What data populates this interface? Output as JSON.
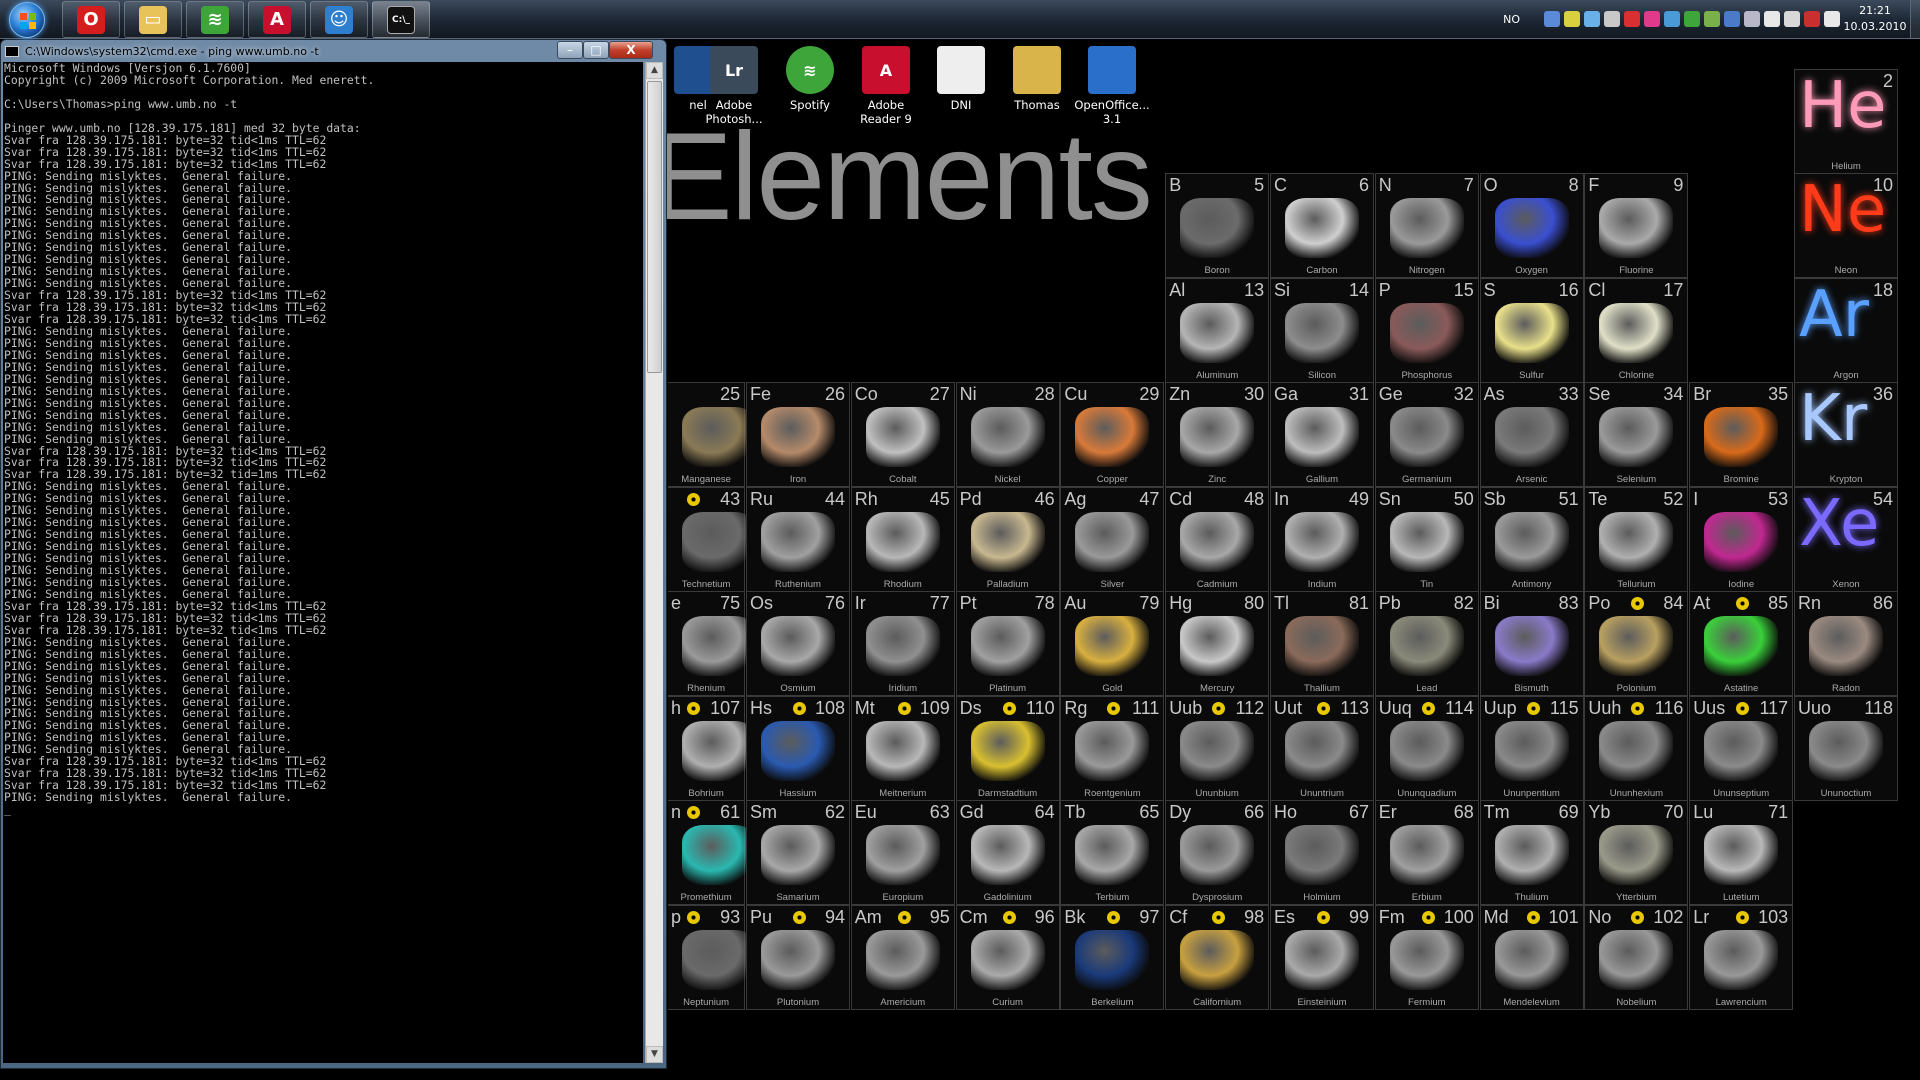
{
  "taskbar": {
    "apps": [
      {
        "name": "Opera",
        "icon": "opera-icon",
        "color": "#d41d1d",
        "glyph": "O"
      },
      {
        "name": "Windows Explorer",
        "icon": "folder-icon",
        "color": "#e8c35a",
        "glyph": "▭"
      },
      {
        "name": "Spotify",
        "icon": "spotify-icon",
        "color": "#3ea53a",
        "glyph": "≋"
      },
      {
        "name": "Adobe Reader",
        "icon": "acrobat-icon",
        "color": "#c8102e",
        "glyph": "A"
      },
      {
        "name": "Users",
        "icon": "users-icon",
        "color": "#2f7fcf",
        "glyph": "☺"
      },
      {
        "name": "Command Prompt",
        "icon": "cmd-icon",
        "color": "#111111",
        "glyph": "C:\\_"
      }
    ],
    "tray_language": "NO",
    "clock_time": "21:21",
    "clock_date": "10.03.2010"
  },
  "cmd": {
    "title": "C:\\Windows\\system32\\cmd.exe - ping  www.umb.no -t",
    "buttons": {
      "minimize": "–",
      "maximize": "□",
      "close": "X"
    },
    "output": "Microsoft Windows [Versjon 6.1.7600]\nCopyright (c) 2009 Microsoft Corporation. Med enerett.\n\nC:\\Users\\Thomas>ping www.umb.no -t\n\nPinger www.umb.no [128.39.175.181] med 32 byte data:\nSvar fra 128.39.175.181: byte=32 tid<1ms TTL=62\nSvar fra 128.39.175.181: byte=32 tid<1ms TTL=62\nSvar fra 128.39.175.181: byte=32 tid<1ms TTL=62\nPING: Sending mislyktes.  General failure.\nPING: Sending mislyktes.  General failure.\nPING: Sending mislyktes.  General failure.\nPING: Sending mislyktes.  General failure.\nPING: Sending mislyktes.  General failure.\nPING: Sending mislyktes.  General failure.\nPING: Sending mislyktes.  General failure.\nPING: Sending mislyktes.  General failure.\nPING: Sending mislyktes.  General failure.\nPING: Sending mislyktes.  General failure.\nSvar fra 128.39.175.181: byte=32 tid<1ms TTL=62\nSvar fra 128.39.175.181: byte=32 tid<1ms TTL=62\nSvar fra 128.39.175.181: byte=32 tid<1ms TTL=62\nPING: Sending mislyktes.  General failure.\nPING: Sending mislyktes.  General failure.\nPING: Sending mislyktes.  General failure.\nPING: Sending mislyktes.  General failure.\nPING: Sending mislyktes.  General failure.\nPING: Sending mislyktes.  General failure.\nPING: Sending mislyktes.  General failure.\nPING: Sending mislyktes.  General failure.\nPING: Sending mislyktes.  General failure.\nPING: Sending mislyktes.  General failure.\nSvar fra 128.39.175.181: byte=32 tid<1ms TTL=62\nSvar fra 128.39.175.181: byte=32 tid<1ms TTL=62\nSvar fra 128.39.175.181: byte=32 tid=1ms TTL=62\nPING: Sending mislyktes.  General failure.\nPING: Sending mislyktes.  General failure.\nPING: Sending mislyktes.  General failure.\nPING: Sending mislyktes.  General failure.\nPING: Sending mislyktes.  General failure.\nPING: Sending mislyktes.  General failure.\nPING: Sending mislyktes.  General failure.\nPING: Sending mislyktes.  General failure.\nPING: Sending mislyktes.  General failure.\nPING: Sending mislyktes.  General failure.\nSvar fra 128.39.175.181: byte=32 tid<1ms TTL=62\nSvar fra 128.39.175.181: byte=32 tid<1ms TTL=62\nSvar fra 128.39.175.181: byte=32 tid<1ms TTL=62\nPING: Sending mislyktes.  General failure.\nPING: Sending mislyktes.  General failure.\nPING: Sending mislyktes.  General failure.\nPING: Sending mislyktes.  General failure.\nPING: Sending mislyktes.  General failure.\nPING: Sending mislyktes.  General failure.\nPING: Sending mislyktes.  General failure.\nPING: Sending mislyktes.  General failure.\nPING: Sending mislyktes.  General failure.\nPING: Sending mislyktes.  General failure.\nSvar fra 128.39.175.181: byte=32 tid<1ms TTL=62\nSvar fra 128.39.175.181: byte=32 tid<1ms TTL=62\nSvar fra 128.39.175.181: byte=32 tid<1ms TTL=62\nPING: Sending mislyktes.  General failure.\n_"
  },
  "desktop_icons": [
    {
      "label": "nel",
      "icon": "control-panel-icon",
      "color": "#1f4f8f",
      "glyph": ""
    },
    {
      "label": "Adobe Photosh...",
      "icon": "lightroom-icon",
      "color": "#3a4a5a",
      "glyph": "Lr"
    },
    {
      "label": "Spotify",
      "icon": "spotify-icon",
      "color": "#3ea53a",
      "glyph": "≋"
    },
    {
      "label": "Adobe Reader 9",
      "icon": "acrobat-icon",
      "color": "#c8102e",
      "glyph": "A"
    },
    {
      "label": "DNI",
      "icon": "document-icon",
      "color": "#eeeeee",
      "glyph": ""
    },
    {
      "label": "Thomas",
      "icon": "user-folder-icon",
      "color": "#d9b44a",
      "glyph": ""
    },
    {
      "label": "OpenOffice... 3.1",
      "icon": "openoffice-icon",
      "color": "#2a6fc9",
      "glyph": ""
    }
  ],
  "wallpaper": {
    "title": "Elements",
    "elements": [
      {
        "sym": "He",
        "num": "2",
        "name": "Helium",
        "glow": "#ff9ab8"
      },
      {
        "sym": "B",
        "num": "5",
        "name": "Boron",
        "color": "#6b6b6b"
      },
      {
        "sym": "C",
        "num": "6",
        "name": "Carbon",
        "color": "#cfcfcf"
      },
      {
        "sym": "N",
        "num": "7",
        "name": "Nitrogen",
        "color": "#9a9a9a"
      },
      {
        "sym": "O",
        "num": "8",
        "name": "Oxygen",
        "color": "#3a4fd0"
      },
      {
        "sym": "F",
        "num": "9",
        "name": "Fluorine",
        "color": "#aaaaaa"
      },
      {
        "sym": "Ne",
        "num": "10",
        "name": "Neon",
        "glow": "#ff3b1a"
      },
      {
        "sym": "Al",
        "num": "13",
        "name": "Aluminum",
        "color": "#b5b5b5"
      },
      {
        "sym": "Si",
        "num": "14",
        "name": "Silicon",
        "color": "#8d8d8d"
      },
      {
        "sym": "P",
        "num": "15",
        "name": "Phosphorus",
        "color": "#8a5a5a"
      },
      {
        "sym": "S",
        "num": "16",
        "name": "Sulfur",
        "color": "#e8e08a"
      },
      {
        "sym": "Cl",
        "num": "17",
        "name": "Chlorine",
        "color": "#e0e0c8"
      },
      {
        "sym": "Ar",
        "num": "18",
        "name": "Argon",
        "glow": "#5aa0ff"
      },
      {
        "sym": "",
        "num": "25",
        "name": "Manganese",
        "color": "#8a7a55",
        "partial": true
      },
      {
        "sym": "Fe",
        "num": "26",
        "name": "Iron",
        "color": "#b58a6a"
      },
      {
        "sym": "Co",
        "num": "27",
        "name": "Cobalt",
        "color": "#c0c0c0"
      },
      {
        "sym": "Ni",
        "num": "28",
        "name": "Nickel",
        "color": "#9a9a9a"
      },
      {
        "sym": "Cu",
        "num": "29",
        "name": "Copper",
        "color": "#d87a3a"
      },
      {
        "sym": "Zn",
        "num": "30",
        "name": "Zinc",
        "color": "#a8a8a8"
      },
      {
        "sym": "Ga",
        "num": "31",
        "name": "Gallium",
        "color": "#bdbdbd"
      },
      {
        "sym": "Ge",
        "num": "32",
        "name": "Germanium",
        "color": "#8a8a8a"
      },
      {
        "sym": "As",
        "num": "33",
        "name": "Arsenic",
        "color": "#7a7a7a"
      },
      {
        "sym": "Se",
        "num": "34",
        "name": "Selenium",
        "color": "#9a9a9a"
      },
      {
        "sym": "Br",
        "num": "35",
        "name": "Bromine",
        "color": "#d86a1a"
      },
      {
        "sym": "Kr",
        "num": "36",
        "name": "Krypton",
        "glow": "#a8c8ff"
      },
      {
        "sym": "",
        "num": "43",
        "name": "Technetium",
        "color": "#6a6a6a",
        "partial": true,
        "rad": true
      },
      {
        "sym": "Ru",
        "num": "44",
        "name": "Ruthenium",
        "color": "#a0a0a0"
      },
      {
        "sym": "Rh",
        "num": "45",
        "name": "Rhodium",
        "color": "#b8b8b8"
      },
      {
        "sym": "Pd",
        "num": "46",
        "name": "Palladium",
        "color": "#c8b890"
      },
      {
        "sym": "Ag",
        "num": "47",
        "name": "Silver",
        "color": "#9a9a9a"
      },
      {
        "sym": "Cd",
        "num": "48",
        "name": "Cadmium",
        "color": "#a8a8a8"
      },
      {
        "sym": "In",
        "num": "49",
        "name": "Indium",
        "color": "#b0b0b0"
      },
      {
        "sym": "Sn",
        "num": "50",
        "name": "Tin",
        "color": "#b8b8b8"
      },
      {
        "sym": "Sb",
        "num": "51",
        "name": "Antimony",
        "color": "#9a9a9a"
      },
      {
        "sym": "Te",
        "num": "52",
        "name": "Tellurium",
        "color": "#b0b0b0"
      },
      {
        "sym": "I",
        "num": "53",
        "name": "Iodine",
        "color": "#c02890"
      },
      {
        "sym": "Xe",
        "num": "54",
        "name": "Xenon",
        "glow": "#7a6aff"
      },
      {
        "sym": "e",
        "num": "75",
        "name": "Rhenium",
        "color": "#9a9a9a",
        "partial": true
      },
      {
        "sym": "Os",
        "num": "76",
        "name": "Osmium",
        "color": "#a8a8a8"
      },
      {
        "sym": "Ir",
        "num": "77",
        "name": "Iridium",
        "color": "#909090"
      },
      {
        "sym": "Pt",
        "num": "78",
        "name": "Platinum",
        "color": "#a0a0a0"
      },
      {
        "sym": "Au",
        "num": "79",
        "name": "Gold",
        "color": "#d8b040"
      },
      {
        "sym": "Hg",
        "num": "80",
        "name": "Mercury",
        "color": "#c8c8c8"
      },
      {
        "sym": "Tl",
        "num": "81",
        "name": "Thallium",
        "color": "#8a6a5a"
      },
      {
        "sym": "Pb",
        "num": "82",
        "name": "Lead",
        "color": "#8a8a7a"
      },
      {
        "sym": "Bi",
        "num": "83",
        "name": "Bismuth",
        "color": "#8a7ac8"
      },
      {
        "sym": "Po",
        "num": "84",
        "name": "Polonium",
        "color": "#b8a060",
        "rad": true
      },
      {
        "sym": "At",
        "num": "85",
        "name": "Astatine",
        "color": "#3ad03a",
        "rad": true
      },
      {
        "sym": "Rn",
        "num": "86",
        "name": "Radon",
        "color": "#9a8a80"
      },
      {
        "sym": "h",
        "num": "107",
        "name": "Bohrium",
        "color": "#b0b0b0",
        "partial": true,
        "rad": true
      },
      {
        "sym": "Hs",
        "num": "108",
        "name": "Hassium",
        "color": "#2a5ab0",
        "rad": true
      },
      {
        "sym": "Mt",
        "num": "109",
        "name": "Meitnerium",
        "color": "#b8b8b8",
        "rad": true
      },
      {
        "sym": "Ds",
        "num": "110",
        "name": "Darmstadtium",
        "color": "#d8c030",
        "rad": true
      },
      {
        "sym": "Rg",
        "num": "111",
        "name": "Roentgenium",
        "color": "#9a9a9a",
        "rad": true
      },
      {
        "sym": "Uub",
        "num": "112",
        "name": "Ununbium",
        "color": "#8a8a8a",
        "rad": true
      },
      {
        "sym": "Uut",
        "num": "113",
        "name": "Ununtrium",
        "color": "#8a8a8a",
        "rad": true
      },
      {
        "sym": "Uuq",
        "num": "114",
        "name": "Ununquadium",
        "color": "#8a8a8a",
        "rad": true
      },
      {
        "sym": "Uup",
        "num": "115",
        "name": "Ununpentium",
        "color": "#8a8a8a",
        "rad": true
      },
      {
        "sym": "Uuh",
        "num": "116",
        "name": "Ununhexium",
        "color": "#8a8a8a",
        "rad": true
      },
      {
        "sym": "Uus",
        "num": "117",
        "name": "Ununseptium",
        "color": "#8a8a8a",
        "rad": true
      },
      {
        "sym": "Uuo",
        "num": "118",
        "name": "Ununoctium",
        "color": "#8a8a8a"
      },
      {
        "sym": "n",
        "num": "61",
        "name": "Promethium",
        "color": "#2ab8b0",
        "partial": true,
        "rad": true
      },
      {
        "sym": "Sm",
        "num": "62",
        "name": "Samarium",
        "color": "#a8a8a8"
      },
      {
        "sym": "Eu",
        "num": "63",
        "name": "Europium",
        "color": "#a0a0a0"
      },
      {
        "sym": "Gd",
        "num": "64",
        "name": "Gadolinium",
        "color": "#b8b8b8"
      },
      {
        "sym": "Tb",
        "num": "65",
        "name": "Terbium",
        "color": "#a8a8a8"
      },
      {
        "sym": "Dy",
        "num": "66",
        "name": "Dysprosium",
        "color": "#9a9a9a"
      },
      {
        "sym": "Ho",
        "num": "67",
        "name": "Holmium",
        "color": "#7a7a7a"
      },
      {
        "sym": "Er",
        "num": "68",
        "name": "Erbium",
        "color": "#a0a0a0"
      },
      {
        "sym": "Tm",
        "num": "69",
        "name": "Thulium",
        "color": "#b0b0b0"
      },
      {
        "sym": "Yb",
        "num": "70",
        "name": "Ytterbium",
        "color": "#9a9a8a"
      },
      {
        "sym": "Lu",
        "num": "71",
        "name": "Lutetium",
        "color": "#b8b8b8"
      },
      {
        "sym": "p",
        "num": "93",
        "name": "Neptunium",
        "color": "#6a6a6a",
        "partial": true,
        "rad": true
      },
      {
        "sym": "Pu",
        "num": "94",
        "name": "Plutonium",
        "color": "#9a9a9a",
        "rad": true
      },
      {
        "sym": "Am",
        "num": "95",
        "name": "Americium",
        "color": "#9a9a9a",
        "rad": true
      },
      {
        "sym": "Cm",
        "num": "96",
        "name": "Curium",
        "color": "#aaaaaa",
        "rad": true
      },
      {
        "sym": "Bk",
        "num": "97",
        "name": "Berkelium",
        "color": "#1a3a7a",
        "rad": true
      },
      {
        "sym": "Cf",
        "num": "98",
        "name": "Californium",
        "color": "#c8a040",
        "rad": true
      },
      {
        "sym": "Es",
        "num": "99",
        "name": "Einsteinium",
        "color": "#aaaaaa",
        "rad": true
      },
      {
        "sym": "Fm",
        "num": "100",
        "name": "Fermium",
        "color": "#999999",
        "rad": true
      },
      {
        "sym": "Md",
        "num": "101",
        "name": "Mendelevium",
        "color": "#999999",
        "rad": true
      },
      {
        "sym": "No",
        "num": "102",
        "name": "Nobelium",
        "color": "#999999",
        "rad": true
      },
      {
        "sym": "Lr",
        "num": "103",
        "name": "Lawrencium",
        "color": "#999999",
        "rad": true
      }
    ]
  }
}
